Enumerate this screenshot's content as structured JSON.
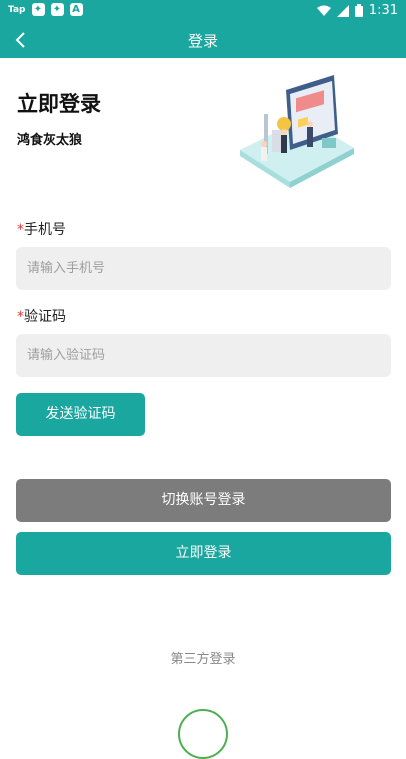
{
  "status_bar": {
    "tap_label": "Tap",
    "time": "1:31"
  },
  "app_bar": {
    "title": "登录"
  },
  "header": {
    "title": "立即登录",
    "subtitle": "鸿食灰太狼"
  },
  "phone": {
    "required_mark": "*",
    "label": "手机号",
    "placeholder": "请输入手机号"
  },
  "code": {
    "required_mark": "*",
    "label": "验证码",
    "placeholder": "请输入验证码"
  },
  "buttons": {
    "send_code": "发送验证码",
    "switch_account": "切换账号登录",
    "login": "立即登录"
  },
  "third_party": {
    "title": "第三方登录"
  },
  "colors": {
    "primary": "#1aa79f",
    "secondary_button": "#7c7c7c",
    "input_bg": "#efefef",
    "required": "#e53935"
  }
}
